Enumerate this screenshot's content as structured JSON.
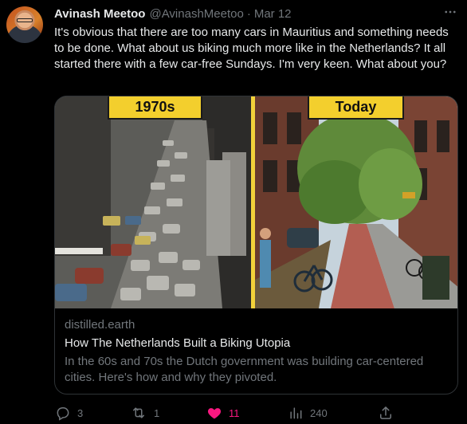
{
  "tweet": {
    "author_name": "Avinash Meetoo",
    "handle": "@AvinashMeetoo",
    "separator": "·",
    "date": "Mar 12",
    "more_icon": "more-icon",
    "text": "It's obvious that there are too many cars in Mauritius and something needs to be done. What about us biking much more like in the Netherlands? It all started there with a few car-free Sundays. I'm very keen. What about you?"
  },
  "card": {
    "image_label_left": "1970s",
    "image_label_right": "Today",
    "domain": "distilled.earth",
    "title": "How The Netherlands Built a Biking Utopia",
    "description": "In the 60s and 70s the Dutch government was building car-centered cities. Here's how and why they pivoted."
  },
  "actions": {
    "reply_count": "3",
    "retweet_count": "1",
    "like_count": "11",
    "views_count": "240",
    "like_color": "#f91880",
    "muted_color": "#71767b"
  }
}
